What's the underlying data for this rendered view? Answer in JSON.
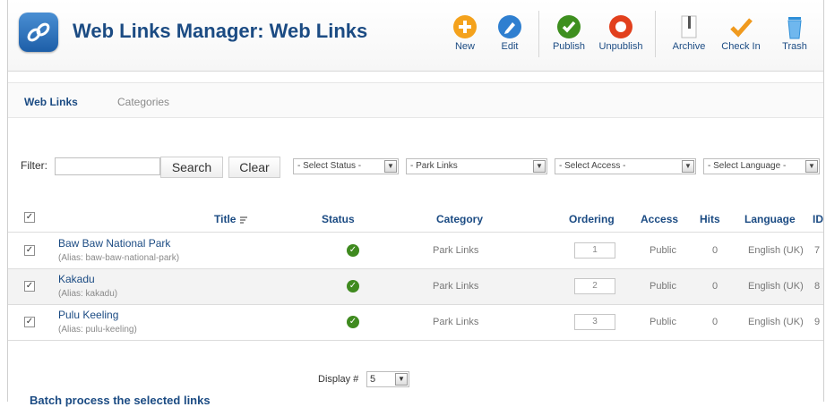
{
  "header": {
    "title": "Web Links Manager: Web Links"
  },
  "toolbar": [
    {
      "label": "New",
      "icon": "plus-icon",
      "color": "#f4a21c"
    },
    {
      "label": "Edit",
      "icon": "pencil-icon",
      "color": "#2f7fd0"
    },
    {
      "label": "Publish",
      "icon": "check-icon",
      "color": "#3e8f1f"
    },
    {
      "label": "Unpublish",
      "icon": "circle-stop-icon",
      "color": "#e2401d"
    },
    {
      "label": "Archive",
      "icon": "archive-icon",
      "color": "#666666"
    },
    {
      "label": "Check In",
      "icon": "checkmark-icon",
      "color": "#f09a1e"
    },
    {
      "label": "Trash",
      "icon": "trash-icon",
      "color": "#2f8fd8"
    }
  ],
  "submenu": {
    "tabs": [
      "Web Links",
      "Categories"
    ]
  },
  "filter": {
    "label": "Filter:",
    "search_label": "Search",
    "clear_label": "Clear",
    "selects": [
      "- Select Status -",
      "- Park Links",
      "- Select Access -",
      "- Select Language -"
    ]
  },
  "table": {
    "headers": {
      "title": "Title",
      "status": "Status",
      "category": "Category",
      "ordering": "Ordering",
      "access": "Access",
      "hits": "Hits",
      "language": "Language",
      "id": "ID"
    },
    "rows": [
      {
        "title": "Baw Baw National Park",
        "alias": "(Alias: baw-baw-national-park)",
        "category": "Park Links",
        "ordering": "1",
        "access": "Public",
        "hits": "0",
        "language": "English (UK)",
        "id": "7"
      },
      {
        "title": "Kakadu",
        "alias": "(Alias: kakadu)",
        "category": "Park Links",
        "ordering": "2",
        "access": "Public",
        "hits": "0",
        "language": "English (UK)",
        "id": "8"
      },
      {
        "title": "Pulu Keeling",
        "alias": "(Alias: pulu-keeling)",
        "category": "Park Links",
        "ordering": "3",
        "access": "Public",
        "hits": "0",
        "language": "English (UK)",
        "id": "9"
      }
    ]
  },
  "pagination": {
    "display_label": "Display #",
    "display_value": "5"
  },
  "batch": {
    "title": "Batch process the selected links"
  }
}
